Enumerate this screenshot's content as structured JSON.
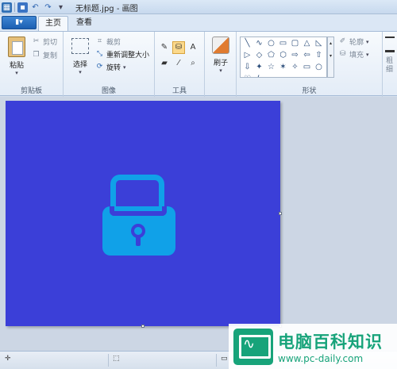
{
  "window": {
    "title": "无标题.jpg - 画图"
  },
  "quick_access": {
    "app_icon": "paint-app-icon",
    "save_icon": "save-icon",
    "undo_icon": "undo-icon",
    "redo_icon": "redo-icon"
  },
  "tabs": {
    "menu_label": "▮▾",
    "home": "主页",
    "view": "查看"
  },
  "clipboard": {
    "paste": "粘贴",
    "cut": "剪切",
    "copy": "复制",
    "group": "剪贴板"
  },
  "image": {
    "select": "选择",
    "crop": "裁剪",
    "resize": "重新调整大小",
    "rotate": "旋转",
    "group": "图像"
  },
  "tools": {
    "group": "工具",
    "items": [
      {
        "name": "pencil-icon",
        "glyph": "✎"
      },
      {
        "name": "fill-icon",
        "glyph": "⛁"
      },
      {
        "name": "text-icon",
        "glyph": "A"
      },
      {
        "name": "eraser-icon",
        "glyph": "▰"
      },
      {
        "name": "color-picker-icon",
        "glyph": "⁄"
      },
      {
        "name": "magnifier-icon",
        "glyph": "⌕"
      }
    ]
  },
  "brushes": {
    "label": "刷子"
  },
  "shapes": {
    "group": "形状",
    "outline": "轮廓",
    "fill": "填充",
    "glyphs": [
      "╲",
      "∿",
      "○",
      "▭",
      "▢",
      "△",
      "◺",
      "▷",
      "◇",
      "⬠",
      "⬡",
      "⇨",
      "⇦",
      "⇧",
      "⇩",
      "✦",
      "☆",
      "✶",
      "✧",
      "▭",
      "○",
      "♡",
      "ϟ"
    ]
  },
  "status": {
    "add_icon": "move-cursor-icon",
    "select_icon": "selection-size-icon",
    "size_icon": "image-size-icon"
  },
  "watermark": {
    "text": "电脑百科知识",
    "url": "www.pc-daily.com"
  },
  "colors": {
    "canvas": "#3b3fd8",
    "lock": "#10a1e8",
    "brand": "#17a37a"
  }
}
